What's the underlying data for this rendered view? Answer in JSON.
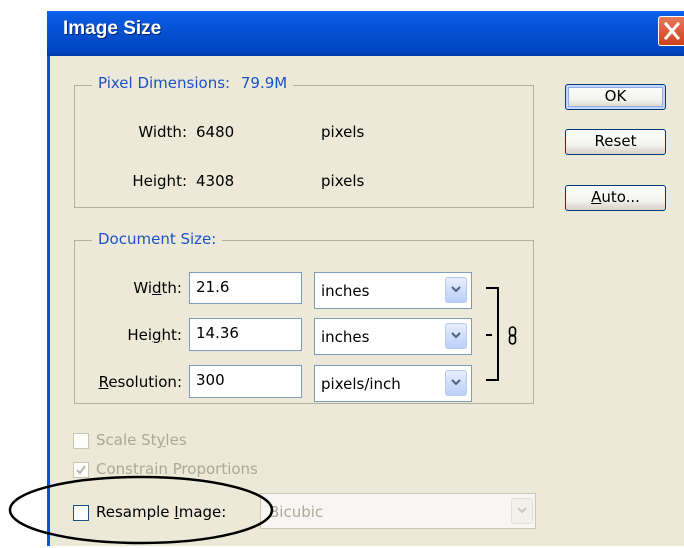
{
  "window": {
    "title": "Image Size"
  },
  "pixel_dimensions": {
    "legend": "Pixel Dimensions:",
    "size": "79.9M",
    "width_label": "Width:",
    "width_value": "6480",
    "width_unit": "pixels",
    "height_label": "Height:",
    "height_value": "4308",
    "height_unit": "pixels"
  },
  "document_size": {
    "legend": "Document Size:",
    "width_label_pre": "Wi",
    "width_label_key": "d",
    "width_label_post": "th:",
    "width_value": "21.6",
    "width_unit": "inches",
    "height_label_pre": "Hei",
    "height_label_key": "g",
    "height_label_post": "ht:",
    "height_value": "14.36",
    "height_unit": "inches",
    "resolution_label_key": "R",
    "resolution_label_post": "esolution:",
    "resolution_value": "300",
    "resolution_unit": "pixels/inch"
  },
  "options": {
    "scale_styles_pre": "Scale St",
    "scale_styles_key": "y",
    "scale_styles_post": "les",
    "scale_styles_checked": false,
    "constrain_label": "Constrain Proportions",
    "constrain_checked": true,
    "resample_pre": "Resample ",
    "resample_key": "I",
    "resample_post": "mage:",
    "resample_checked": false,
    "resample_method": "Bicubic"
  },
  "buttons": {
    "ok": "OK",
    "reset": "Reset",
    "auto_key": "A",
    "auto_post": "uto..."
  }
}
